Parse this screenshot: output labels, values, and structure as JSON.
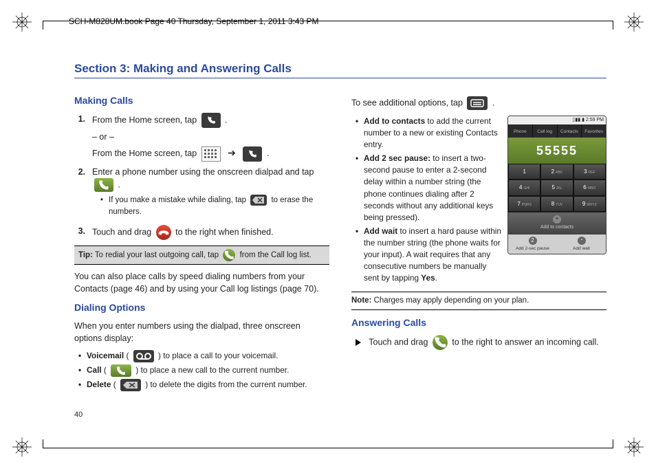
{
  "running_head": "SCH-M828UM.book  Page 40  Thursday, September 1, 2011  3:43 PM",
  "page_number": "40",
  "section_title": "Section 3: Making and Answering Calls",
  "left": {
    "making_head": "Making Calls",
    "step1_a": "From the Home screen, tap",
    "step1_b": ".",
    "or": "– or –",
    "step1_c": "From the Home screen, tap",
    "step1_d": ".",
    "step2_a": "Enter a phone number using the onscreen dialpad and tap",
    "step2_b": ".",
    "step2_sub_a": "If you make a mistake while dialing, tap",
    "step2_sub_b": "to erase the numbers.",
    "step3_a": "Touch and drag",
    "step3_b": "to the right when finished.",
    "tip_label": "Tip:",
    "tip_a": "To redial your last outgoing call, tap",
    "tip_b": "from the Call log list.",
    "para_speed": "You can also place calls by speed dialing numbers from your Contacts (page 46) and by using your Call log listings (page 70).",
    "dial_opts_head": "Dialing Options",
    "dial_intro": "When you enter numbers using the dialpad, three onscreen options display:",
    "vm_label": "Voicemail",
    "vm_text": ") to place a call to your voicemail.",
    "call_label": "Call",
    "call_text": ") to place a new call to the current number.",
    "del_label": "Delete",
    "del_text": ") to delete the digits from the current number."
  },
  "right": {
    "see_more_a": "To see additional options, tap",
    "see_more_b": ".",
    "addc_label": "Add to contacts",
    "addc_text": "to add the current number to a new or existing Contacts entry.",
    "pause_label": "Add 2 sec pause:",
    "pause_text": "to insert a two-second pause to enter a 2-second delay within a number string (the phone continues dialing after 2 seconds without any additional keys being pressed).",
    "wait_label": "Add wait",
    "wait_text_a": "to insert a hard pause within the number string (the phone waits for your input). A wait requires that any consecutive numbers be manually sent by tapping",
    "wait_yes": "Yes",
    "wait_text_b": ".",
    "note_label": "Note:",
    "note_text": "Charges may apply depending on your plan.",
    "answer_head": "Answering Calls",
    "answer_a": "Touch and drag",
    "answer_b": "to the right to answer an incoming call."
  },
  "mock": {
    "time": "2:59 PM",
    "tabs": [
      "Phone",
      "Call log",
      "Contacts",
      "Favorites"
    ],
    "number": "55555",
    "keys": [
      {
        "d": "1",
        "l": ""
      },
      {
        "d": "2",
        "l": "ABC"
      },
      {
        "d": "3",
        "l": "DEF"
      },
      {
        "d": "4",
        "l": "GHI"
      },
      {
        "d": "5",
        "l": "JKL"
      },
      {
        "d": "6",
        "l": "MNO"
      },
      {
        "d": "7",
        "l": "PQRS"
      },
      {
        "d": "8",
        "l": "TUV"
      },
      {
        "d": "9",
        "l": "WXYZ"
      }
    ],
    "add_contacts": "Add to contacts",
    "opt1": "Add 2-sec pause",
    "opt2": "Add wait"
  }
}
